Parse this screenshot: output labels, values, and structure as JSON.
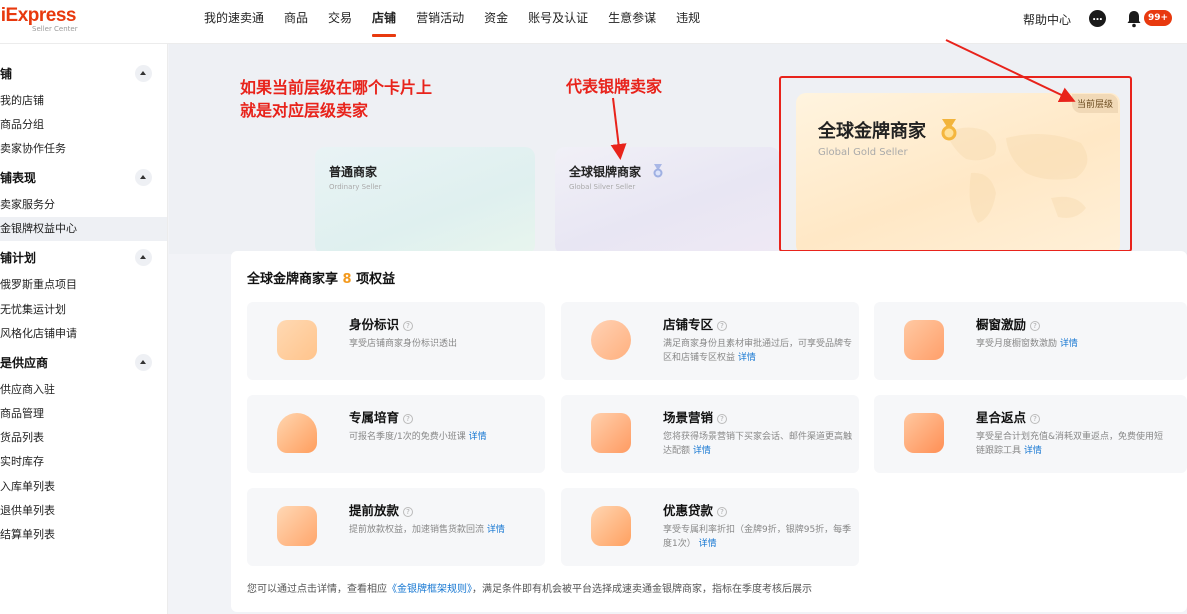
{
  "topbar": {
    "brand": "liExpress",
    "brand_sub": "Seller Center",
    "nav": [
      "我的速卖通",
      "商品",
      "交易",
      "店铺",
      "营销活动",
      "资金",
      "账号及认证",
      "生意参谋",
      "违规"
    ],
    "active_nav": "店铺",
    "help": "帮助中心",
    "notif_badge": "99+"
  },
  "sidebar": {
    "groups": [
      {
        "label": "铺",
        "items": [
          "我的店铺",
          "商品分组",
          "卖家协作任务"
        ]
      },
      {
        "label": "铺表现",
        "items": [
          "卖家服务分",
          "金银牌权益中心"
        ]
      },
      {
        "label": "铺计划",
        "items": [
          "俄罗斯重点项目",
          "无忧集运计划",
          "风格化店铺申请"
        ]
      },
      {
        "label": "是供应商",
        "items": [
          "供应商入驻",
          "商品管理",
          "货品列表",
          "实时库存",
          "入库单列表",
          "退供单列表",
          "结算单列表"
        ]
      }
    ],
    "active_item": "金银牌权益中心"
  },
  "annotations": {
    "left_line1": "如果当前层级在哪个卡片上",
    "left_line2": "就是对应层级卖家",
    "middle": "代表银牌卖家"
  },
  "tiers": [
    {
      "title": "普通商家",
      "subtitle": "Ordinary Seller"
    },
    {
      "title": "全球银牌商家",
      "subtitle": "Global Silver Seller"
    },
    {
      "title": "全球金牌商家",
      "subtitle": "Global Gold Seller",
      "tag": "当前层级"
    }
  ],
  "benefits": {
    "title_prefix": "全球金牌商家享",
    "count": "8",
    "title_suffix": "项权益",
    "items": [
      {
        "title": "身份标识",
        "desc": "享受店铺商家身份标识透出",
        "link": ""
      },
      {
        "title": "店铺专区",
        "desc": "满足商家身份且素材审批通过后，可享受品牌专区和店铺专区权益",
        "link": "详情"
      },
      {
        "title": "橱窗激励",
        "desc": "享受月度橱窗数激励",
        "link": "详情"
      },
      {
        "title": "专属培育",
        "desc": "可报名季度/1次的免费小班课",
        "link": "详情"
      },
      {
        "title": "场景营销",
        "desc": "您将获得场景营销下买家会话、邮件渠道更高触达配额",
        "link": "详情"
      },
      {
        "title": "星合返点",
        "desc": "享受星合计划充值&消耗双重返点，免费使用短链跟踪工具",
        "link": "详情"
      },
      {
        "title": "提前放款",
        "desc": "提前放款权益，加速销售货款回流",
        "link": "详情"
      },
      {
        "title": "优惠贷款",
        "desc": "享受专属利率折扣（金牌9折，银牌95折，每季度1次）",
        "link": "详情"
      }
    ]
  },
  "footer": {
    "before": "您可以通过点击详情，查看相应",
    "link": "《金银牌框架规则》",
    "after": "，满足条件即有机会被平台选择成速卖通金银牌商家，指标在季度考核后展示"
  },
  "colors": {
    "accent": "#e8390e",
    "annotation": "#e8231b",
    "gold_count": "#f39a1e",
    "link": "#1677d2"
  }
}
